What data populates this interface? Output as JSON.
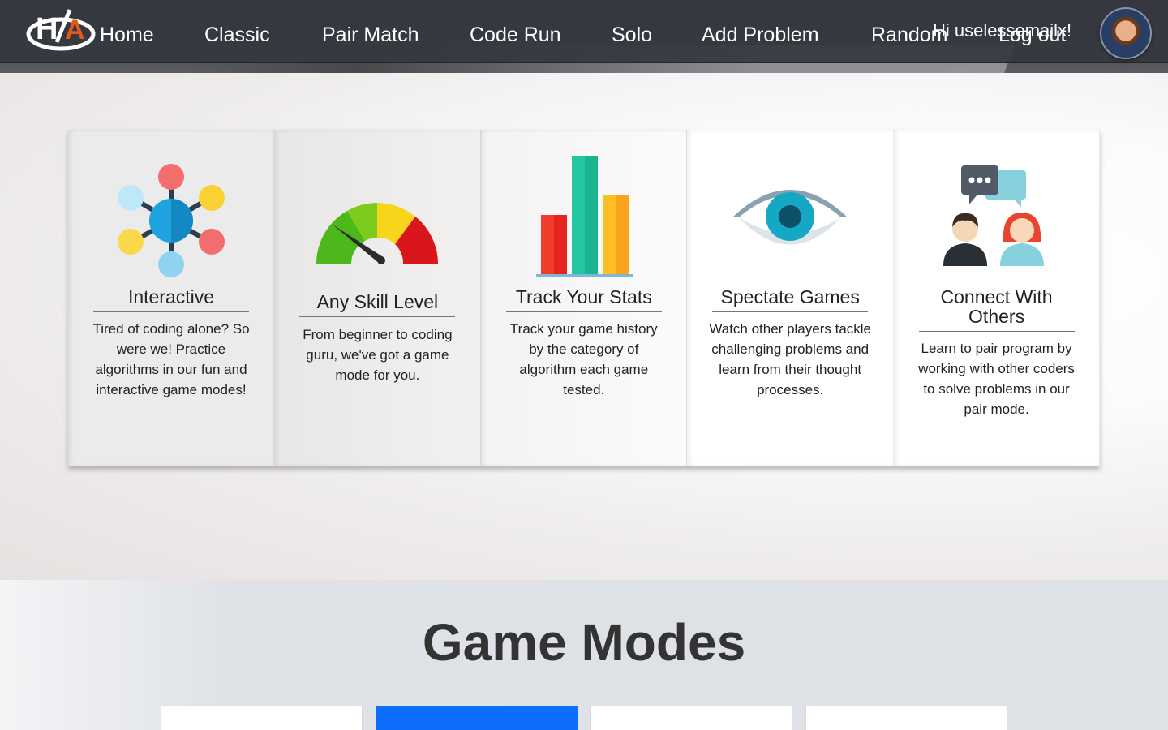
{
  "nav": {
    "links": [
      "Home",
      "Classic",
      "Pair Match",
      "Code Run",
      "Solo",
      "Add Problem",
      "Random"
    ],
    "logout": "Log out",
    "greeting": "Hi uselessemailx!",
    "logo_text": "H/A"
  },
  "features": [
    {
      "title": "Interactive",
      "text": "Tired of coding alone? So were we! Practice algorithms in our fun and interactive game modes!",
      "icon": "network-icon"
    },
    {
      "title": "Any Skill Level",
      "text": "From beginner to coding guru, we've got a game mode for you.",
      "icon": "gauge-icon"
    },
    {
      "title": "Track Your Stats",
      "text": "Track your game history by the category of algorithm each game tested.",
      "icon": "bar-chart-icon"
    },
    {
      "title": "Spectate Games",
      "text": "Watch other players tackle challenging problems and learn from their thought processes.",
      "icon": "eye-icon"
    },
    {
      "title": "Connect With Others",
      "text": "Learn to pair program by working with other coders to solve problems in our pair mode.",
      "icon": "people-chat-icon"
    }
  ],
  "modes": {
    "heading": "Game Modes"
  },
  "colors": {
    "accent": "#0d6efd",
    "nav_bg": "#353840"
  }
}
